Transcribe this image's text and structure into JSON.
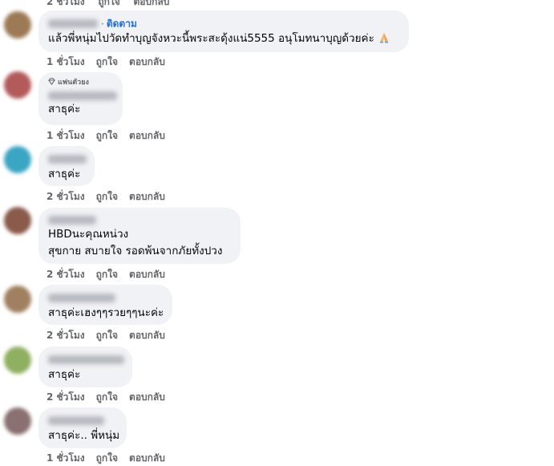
{
  "top_cut": {
    "time": "2 ชั่วโมง",
    "like": "ถูกใจ",
    "reply": "ตอบกลับ"
  },
  "comments": [
    {
      "follow": "ติดตาม",
      "text": [
        "แล้วพี่หนุ่มไปวัดทำบุญจังหวะนี้พระสะดุ้งแน่5555 อนุโมทนาบุญด้วยค่ะ"
      ],
      "emoji": "folded-hands-emoji",
      "time": "1 ชั่วโมง",
      "like": "ถูกใจ",
      "reply": "ตอบกลับ",
      "avatar_color": "#9c7a55"
    },
    {
      "badge": "แฟนตัวยง",
      "text": [
        "สาธุค่ะ"
      ],
      "time": "1 ชั่วโมง",
      "like": "ถูกใจ",
      "reply": "ตอบกลับ",
      "avatar_color": "#b35a5a"
    },
    {
      "text": [
        "สาธุค่ะ"
      ],
      "time": "2 ชั่วโมง",
      "like": "ถูกใจ",
      "reply": "ตอบกลับ",
      "avatar_color": "#3aa6c4"
    },
    {
      "text": [
        "HBDนะคุณหน่วง",
        "สุขกาย สบายใจ รอดพ้นจากภัยทั้งปวง"
      ],
      "time": "2 ชั่วโมง",
      "like": "ถูกใจ",
      "reply": "ตอบกลับ",
      "avatar_color": "#8a5a4a"
    },
    {
      "text": [
        "สาธุค่ะเฮงๆๆรวยๆๆนะค่ะ"
      ],
      "time": "2 ชั่วโมง",
      "like": "ถูกใจ",
      "reply": "ตอบกลับ",
      "avatar_color": "#a08060"
    },
    {
      "text": [
        "สาธุค่ะ"
      ],
      "time": "2 ชั่วโมง",
      "like": "ถูกใจ",
      "reply": "ตอบกลับ",
      "avatar_color": "#8fb060"
    },
    {
      "text": [
        "สาธุค่ะ.. พี่หนุ่ม"
      ],
      "time": "1 ชั่วโมง",
      "like": "ถูกใจ",
      "reply": "ตอบกลับ",
      "avatar_color": "#8a7070"
    }
  ]
}
